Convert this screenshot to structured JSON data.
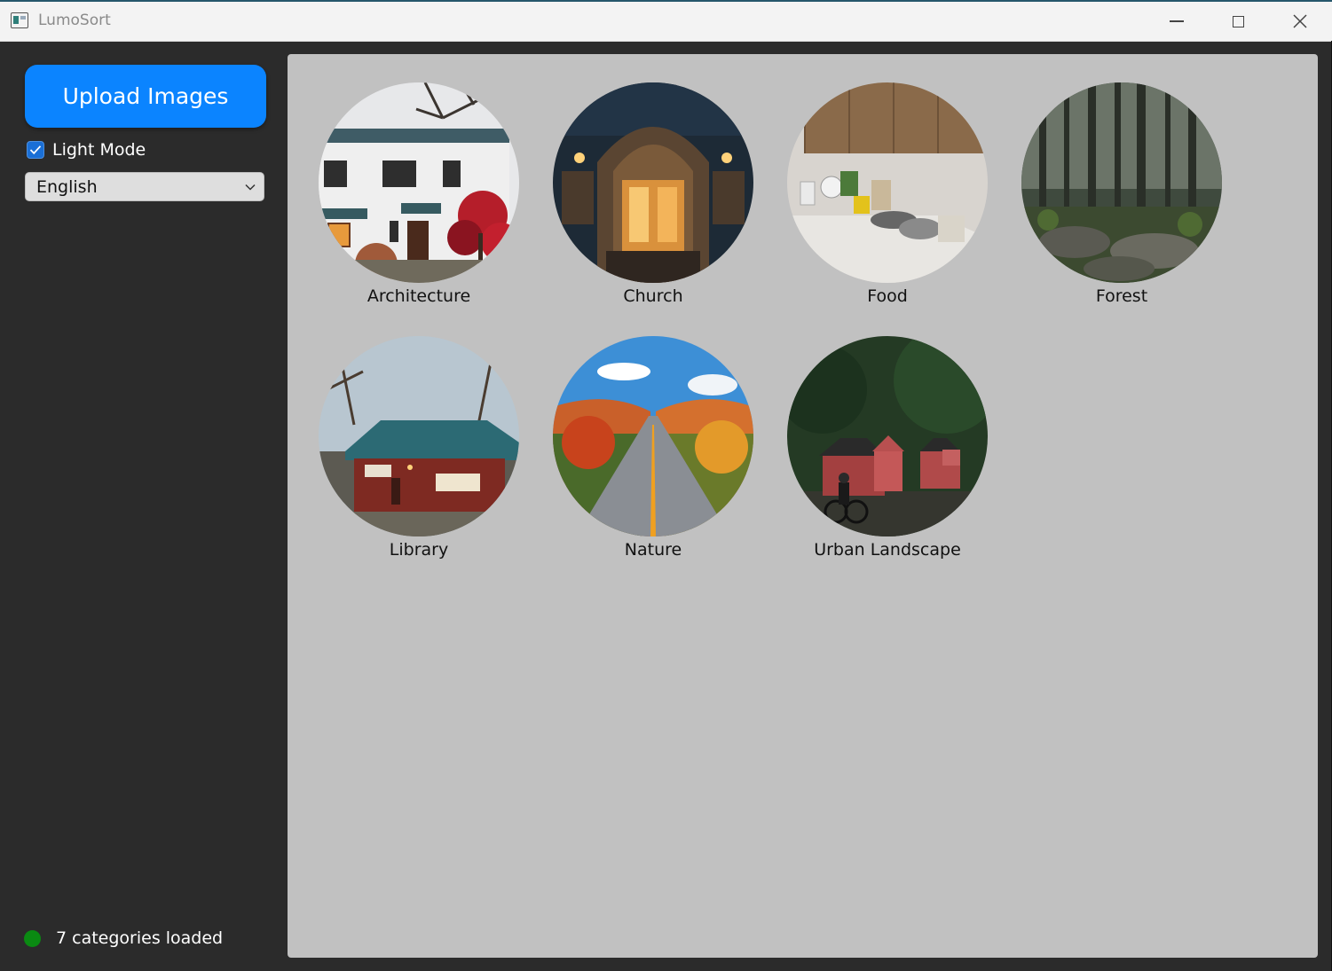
{
  "window": {
    "title": "LumoSort"
  },
  "sidebar": {
    "upload_label": "Upload Images",
    "light_mode_label": "Light Mode",
    "light_mode_checked": true,
    "language_selected": "English",
    "status_text": "7 categories loaded",
    "status_color": "#0a8a12",
    "accent_color": "#0b84ff"
  },
  "main": {
    "categories": [
      {
        "label": "Architecture",
        "icon": "white-house-photo"
      },
      {
        "label": "Church",
        "icon": "church-doorway-photo"
      },
      {
        "label": "Food",
        "icon": "kitchen-counter-photo"
      },
      {
        "label": "Forest",
        "icon": "forest-photo"
      },
      {
        "label": "Library",
        "icon": "red-house-photo"
      },
      {
        "label": "Nature",
        "icon": "autumn-road-photo"
      },
      {
        "label": "Urban Landscape",
        "icon": "street-houses-photo"
      }
    ]
  }
}
